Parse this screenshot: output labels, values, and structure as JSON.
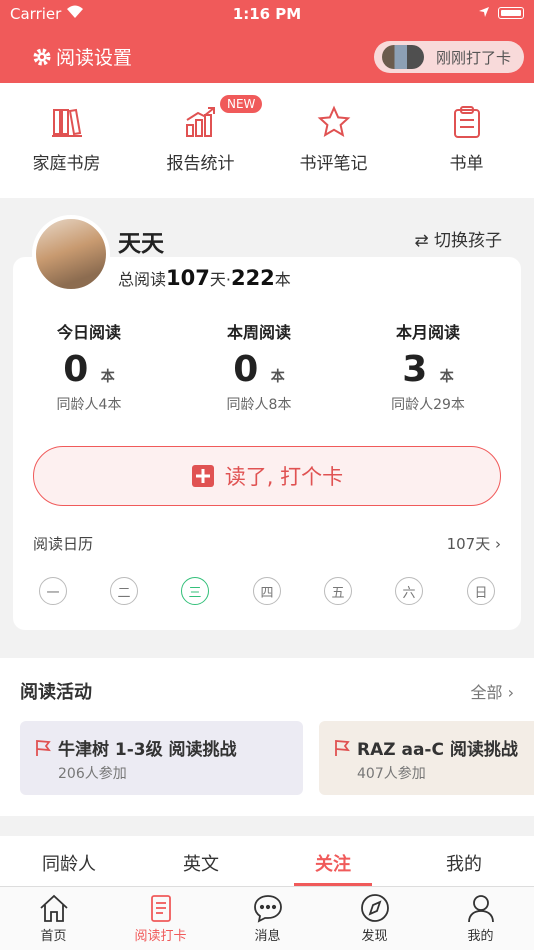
{
  "status_bar": {
    "carrier": "Carrier",
    "time": "1:16 PM"
  },
  "header": {
    "settings_label": "阅读设置",
    "checkin_pill_label": "刚刚打了卡"
  },
  "quick_actions": [
    {
      "label": "家庭书房",
      "icon": "books-icon"
    },
    {
      "label": "报告统计",
      "icon": "bar-chart-icon",
      "badge": "NEW"
    },
    {
      "label": "书评笔记",
      "icon": "star-icon"
    },
    {
      "label": "书单",
      "icon": "clipboard-icon"
    }
  ],
  "profile": {
    "name": "天天",
    "switch_label": "切换孩子",
    "total_prefix": "总阅读",
    "total_days": "107",
    "total_days_unit": "天·",
    "total_books": "222",
    "total_books_unit": "本"
  },
  "stats": [
    {
      "label": "今日阅读",
      "value": "0",
      "unit": "本",
      "peer": "同龄人4本"
    },
    {
      "label": "本周阅读",
      "value": "0",
      "unit": "本",
      "peer": "同龄人8本"
    },
    {
      "label": "本月阅读",
      "value": "3",
      "unit": "本",
      "peer": "同龄人29本"
    }
  ],
  "checkin_button": "读了, 打个卡",
  "calendar": {
    "title": "阅读日历",
    "days_label": "107天",
    "weekdays": [
      "一",
      "二",
      "三",
      "四",
      "五",
      "六",
      "日"
    ],
    "today": "三"
  },
  "activities": {
    "title": "阅读活动",
    "all_label": "全部",
    "items": [
      {
        "title": "牛津树 1-3级 阅读挑战",
        "participants": "206人参加",
        "bg": "#ecebf3"
      },
      {
        "title": "RAZ aa-C 阅读挑战",
        "participants": "407人参加",
        "bg": "#f3ede6"
      }
    ]
  },
  "feed_tabs": {
    "items": [
      "同龄人",
      "英文",
      "关注",
      "我的"
    ],
    "active": "关注"
  },
  "bottom_nav": {
    "items": [
      "首页",
      "阅读打卡",
      "消息",
      "发现",
      "我的"
    ],
    "active": "阅读打卡"
  },
  "colors": {
    "brand": "#f05a5a",
    "today": "#34c07a"
  }
}
